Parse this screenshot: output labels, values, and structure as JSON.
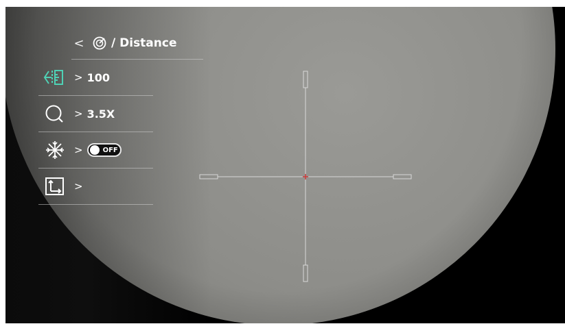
{
  "menu": {
    "back_glyph": "<",
    "title": "/ Distance",
    "title_icon": "target-icon",
    "items": [
      {
        "name": "distance-measure",
        "icon": "distance-measure-icon",
        "chevron": ">",
        "value": "100"
      },
      {
        "name": "zoom",
        "icon": "magnifier-icon",
        "chevron": ">",
        "value": "3.5X"
      },
      {
        "name": "freeze",
        "icon": "snowflake-icon",
        "chevron": ">",
        "toggle_label": "OFF"
      },
      {
        "name": "position",
        "icon": "crop-position-icon",
        "chevron": ">"
      }
    ]
  },
  "colors": {
    "accent": "#4fd1b5",
    "reticle": "#d8d8d8",
    "reticle_center": "#d23a3a"
  }
}
